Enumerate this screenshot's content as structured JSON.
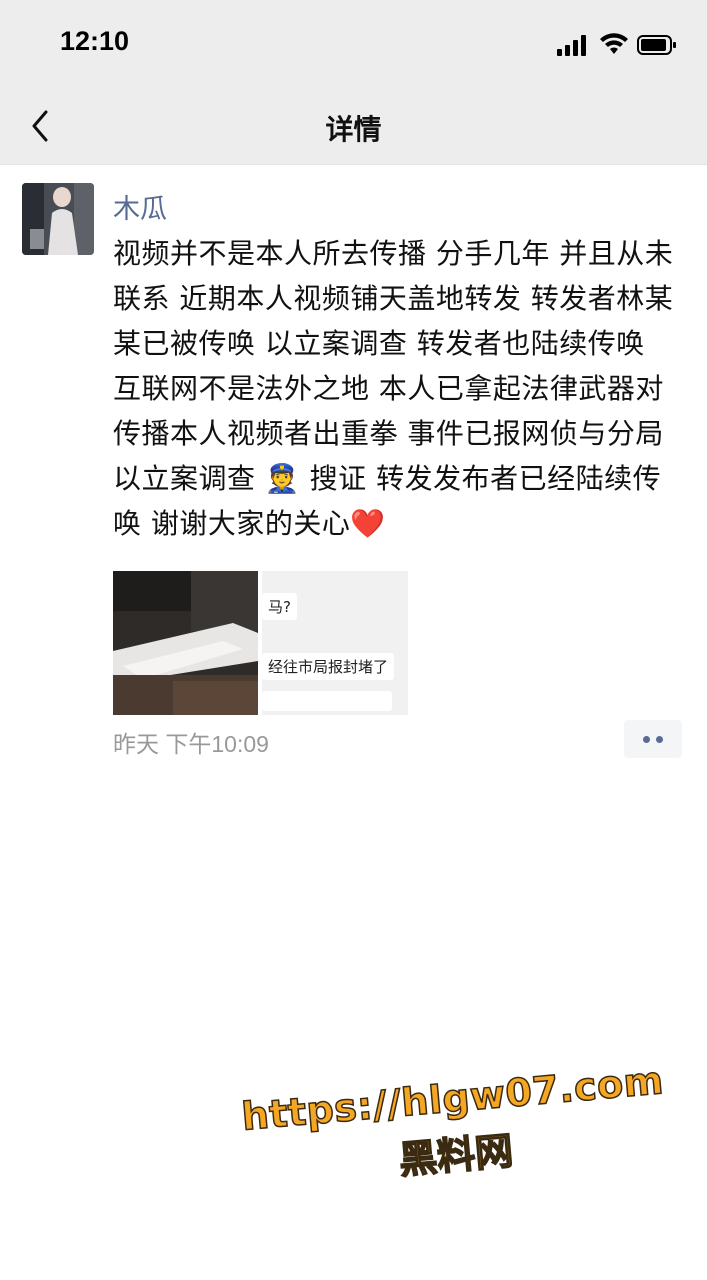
{
  "status_bar": {
    "time": "12:10",
    "icons": [
      "signal-icon",
      "wifi-icon",
      "battery-icon"
    ]
  },
  "nav": {
    "title": "详情",
    "back_icon": "chevron-left-icon"
  },
  "post": {
    "author": "木瓜",
    "text": "视频并不是本人所去传播 分手几年 并且从未联系 近期本人视频铺天盖地转发 转发者林某某已被传唤 以立案调查 转发者也陆续传唤 互联网不是法外之地 本人已拿起法律武器对传播本人视频者出重拳 事件已报网侦与分局 以立案调查 👮 搜证 转发发布者已经陆续传唤 谢谢大家的关心❤️",
    "images": [
      {
        "label": "photo-thumbnail"
      },
      {
        "label": "chat-screenshot-thumbnail",
        "bubbles": [
          "马?",
          "经往市局报封堵了"
        ]
      }
    ],
    "time": "昨天 下午10:09",
    "more_icon": "more-dots-icon"
  },
  "watermark": {
    "url": "https://hlgw07.com",
    "name": "黑料网"
  },
  "colors": {
    "nav_bg": "#ededed",
    "name_link": "#576b95",
    "timestamp": "#999999",
    "watermark": "#f5a623"
  }
}
